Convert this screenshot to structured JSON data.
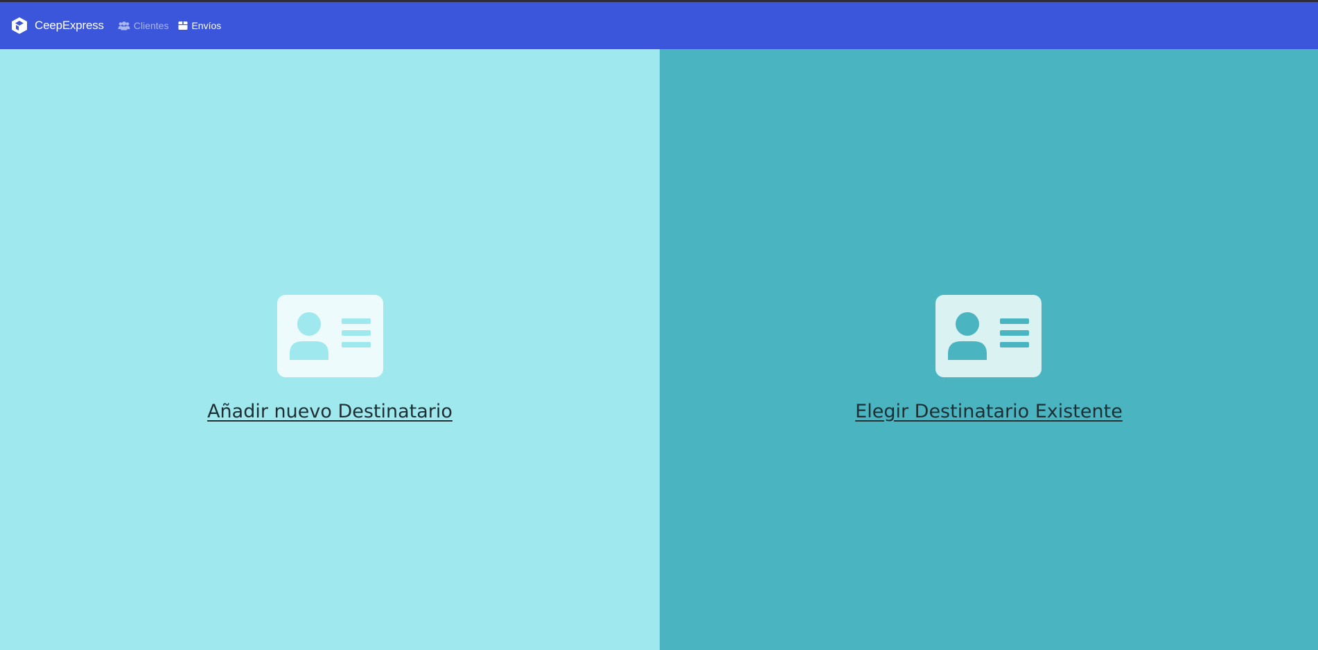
{
  "navbar": {
    "brand_name": "CeepExpress",
    "brand_icon": "box-logo-icon",
    "links": [
      {
        "label": "Clientes",
        "icon": "users-icon",
        "active": false
      },
      {
        "label": "Envíos",
        "icon": "package-icon",
        "active": true
      }
    ],
    "color": "#3b55db"
  },
  "panels": {
    "left": {
      "label": "Añadir nuevo Destinatario",
      "icon": "id-card-icon",
      "background": "#9ee8ee"
    },
    "right": {
      "label": "Elegir Destinatario Existente",
      "icon": "id-card-icon",
      "background": "#4ab4c0"
    }
  }
}
